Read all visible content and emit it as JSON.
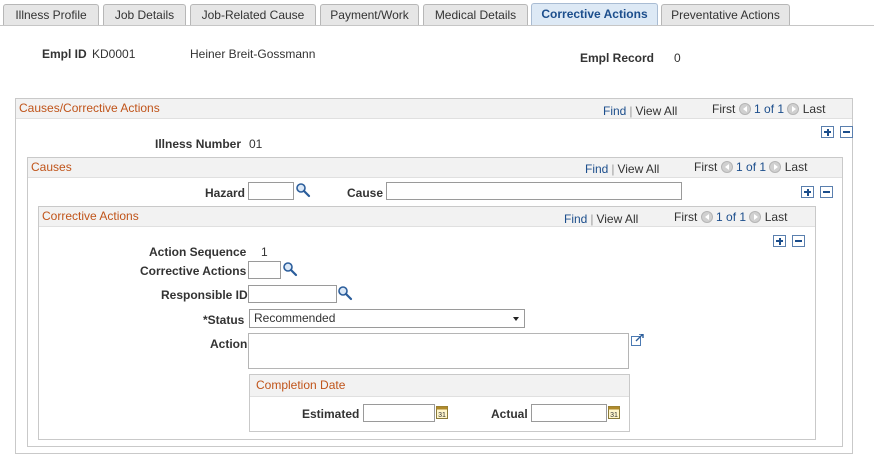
{
  "tabs": [
    {
      "label": "Illness Profile",
      "active": false
    },
    {
      "label": "Job Details",
      "active": false
    },
    {
      "label": "Job-Related Cause",
      "active": false
    },
    {
      "label": "Payment/Work",
      "active": false
    },
    {
      "label": "Medical Details",
      "active": false
    },
    {
      "label": "Corrective Actions",
      "active": true
    },
    {
      "label": "Preventative Actions",
      "active": false
    }
  ],
  "header": {
    "empl_id_label": "Empl ID",
    "empl_id_value": "KD0001",
    "employee_name": "Heiner Breit-Gossmann",
    "empl_record_label": "Empl Record",
    "empl_record_value": "0"
  },
  "nav": {
    "find": "Find",
    "view_all": "View All",
    "first": "First",
    "pager": "1 of 1",
    "last": "Last"
  },
  "causes_corrective": {
    "title": "Causes/Corrective Actions",
    "illness_number_label": "Illness Number",
    "illness_number_value": "01"
  },
  "causes": {
    "title": "Causes",
    "hazard_label": "Hazard",
    "hazard_value": "",
    "cause_label": "Cause",
    "cause_value": ""
  },
  "corrective_actions": {
    "title": "Corrective Actions",
    "action_sequence_label": "Action Sequence",
    "action_sequence_value": "1",
    "corrective_actions_label": "Corrective Actions",
    "corrective_actions_value": "",
    "responsible_id_label": "Responsible ID",
    "responsible_id_value": "",
    "status_label": "*Status",
    "status_value": "Recommended",
    "action_label": "Action",
    "action_value": ""
  },
  "completion_date": {
    "title": "Completion Date",
    "estimated_label": "Estimated",
    "estimated_value": "",
    "actual_label": "Actual",
    "actual_value": ""
  },
  "colors": {
    "accent": "#1c4e8c",
    "section_title": "#c0541a",
    "active_tab_bg": "#dde9f5"
  },
  "icons": {
    "lookup": "magnifier-icon",
    "calendar": "calendar-icon",
    "expand": "expand-textarea-icon",
    "add_row": "plus-icon",
    "delete_row": "minus-icon"
  }
}
